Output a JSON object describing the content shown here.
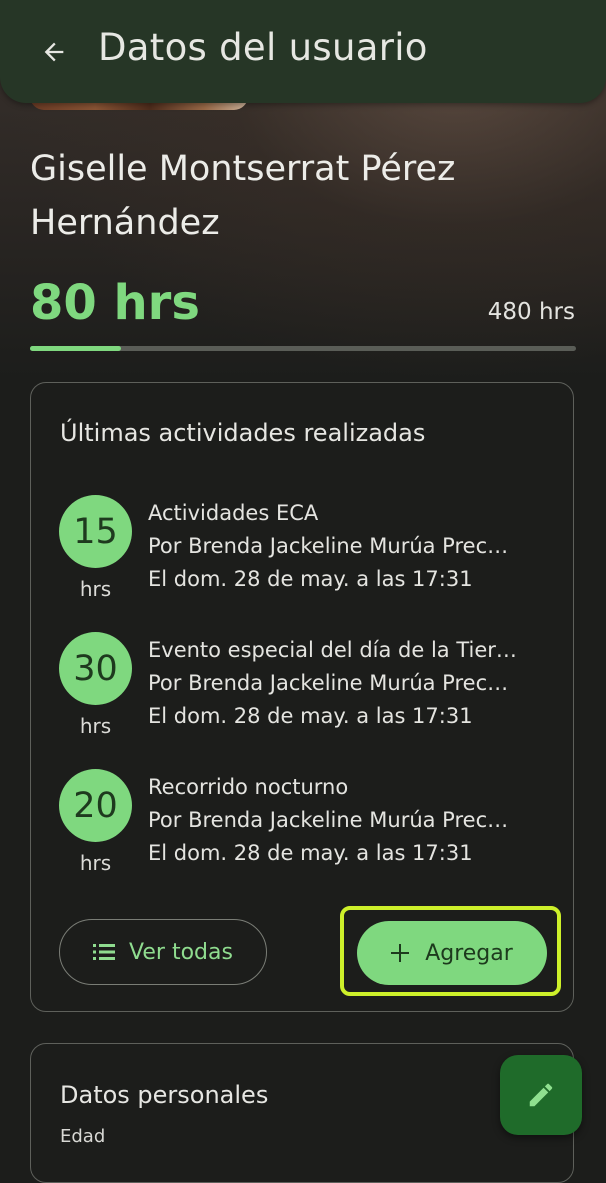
{
  "app_bar": {
    "title": "Datos del usuario"
  },
  "user": {
    "full_name": "Giselle Montserrat Pérez Hernández",
    "hours_completed": "80 hrs",
    "hours_required": "480 hrs",
    "progress_fraction": 0.1667
  },
  "activities_card": {
    "title": "Últimas actividades realizadas",
    "items": [
      {
        "hours": "15",
        "unit": "hrs",
        "name": "Actividades ECA",
        "by": "Por Brenda Jackeline Murúa Prec…",
        "date": "El dom. 28 de may. a las 17:31"
      },
      {
        "hours": "30",
        "unit": "hrs",
        "name": "Evento especial del día de la Tier…",
        "by": "Por Brenda Jackeline Murúa Prec…",
        "date": "El dom. 28 de may. a las 17:31"
      },
      {
        "hours": "20",
        "unit": "hrs",
        "name": "Recorrido nocturno",
        "by": "Por Brenda Jackeline Murúa Prec…",
        "date": "El dom. 28 de may. a las 17:31"
      }
    ],
    "view_all_label": "Ver todas",
    "add_label": "Agregar"
  },
  "personal_card": {
    "title": "Datos personales",
    "age_label": "Edad"
  },
  "colors": {
    "accent_green": "#7fd87f",
    "app_bar": "#263626",
    "fab": "#1f6b2a",
    "highlight": "#cdf02a"
  },
  "icons": {
    "back": "arrow-left-icon",
    "list": "list-icon",
    "add": "plus-icon",
    "edit": "pencil-icon"
  }
}
